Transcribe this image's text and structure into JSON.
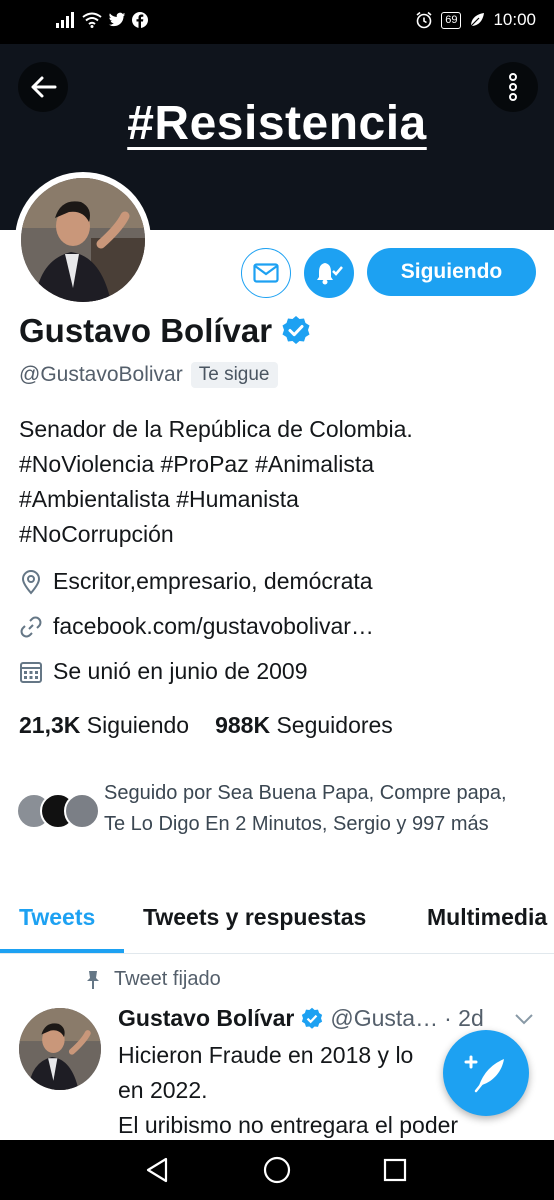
{
  "status_bar": {
    "time": "10:00",
    "battery": "69"
  },
  "banner": {
    "text": "#Resistencia"
  },
  "profile": {
    "name": "Gustavo Bolívar",
    "handle": "@GustavoBolivar",
    "follows_you": "Te sigue",
    "follow_button": "Siguiendo",
    "bio_lines": [
      "Senador de la República de Colombia.",
      "#NoViolencia #ProPaz #Animalista",
      "#Ambientalista #Humanista",
      "#NoCorrupción"
    ],
    "location": "Escritor,empresario, demócrata",
    "website": "facebook.com/gustavobolivar…",
    "joined": "Se unió en junio de 2009",
    "following_count": "21,3K",
    "following_label": "Siguiendo",
    "followers_count": "988K",
    "followers_label": "Seguidores",
    "followed_by": "Seguido por Sea Buena Papa, Compre papa, Te Lo Digo En 2 Minutos, Sergio y 997 más"
  },
  "tabs": [
    {
      "label": "Tweets",
      "active": true
    },
    {
      "label": "Tweets y respuestas",
      "active": false
    },
    {
      "label": "Multimedia",
      "active": false
    }
  ],
  "tweet": {
    "pinned_label": "Tweet fijado",
    "name": "Gustavo Bolívar",
    "handle": "@Gusta…",
    "time": "· 2d",
    "text_lines": [
      "Hicieron Fraude en 2018 y lo",
      "en 2022.",
      "El uribismo no entregara el poder"
    ]
  },
  "colors": {
    "accent": "#1da1f2",
    "banner": "#0f141c"
  }
}
